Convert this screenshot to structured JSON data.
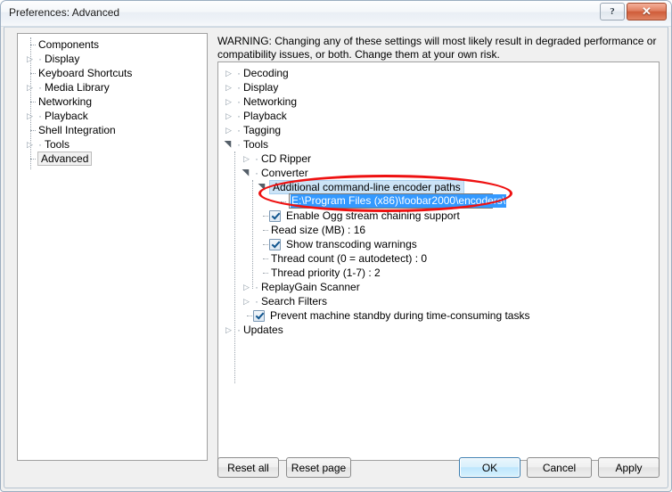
{
  "window": {
    "title": "Preferences: Advanced",
    "help_button": "?",
    "close_button": "✕"
  },
  "left_tree": {
    "items": [
      {
        "label": "Components",
        "expandable": false,
        "selected": false
      },
      {
        "label": "Display",
        "expandable": true,
        "selected": false
      },
      {
        "label": "Keyboard Shortcuts",
        "expandable": false,
        "selected": false
      },
      {
        "label": "Media Library",
        "expandable": true,
        "selected": false
      },
      {
        "label": "Networking",
        "expandable": false,
        "selected": false
      },
      {
        "label": "Playback",
        "expandable": true,
        "selected": false
      },
      {
        "label": "Shell Integration",
        "expandable": false,
        "selected": false
      },
      {
        "label": "Tools",
        "expandable": true,
        "selected": false
      },
      {
        "label": "Advanced",
        "expandable": false,
        "selected": true
      }
    ]
  },
  "warning": {
    "text": "WARNING: Changing any of these settings will most likely result in degraded performance or compatibility issues, or both. Change them at your own risk."
  },
  "right_tree": {
    "items": [
      {
        "label": "Decoding"
      },
      {
        "label": "Display"
      },
      {
        "label": "Networking"
      },
      {
        "label": "Playback"
      },
      {
        "label": "Tagging"
      },
      {
        "label": "Tools"
      },
      {
        "label": "CD Ripper"
      },
      {
        "label": "Converter"
      },
      {
        "label": "Additional command-line encoder paths"
      },
      {
        "label": "Enable Ogg stream chaining support"
      },
      {
        "label": "Read size (MB) : 16"
      },
      {
        "label": "Show transcoding warnings"
      },
      {
        "label": "Thread count (0 = autodetect) : 0"
      },
      {
        "label": "Thread priority (1-7) : 2"
      },
      {
        "label": "ReplayGain Scanner"
      },
      {
        "label": "Search Filters"
      },
      {
        "label": "Prevent machine standby during time-consuming tasks"
      },
      {
        "label": "Updates"
      }
    ]
  },
  "editor": {
    "value": "E:\\Program Files (x86)\\foobar2000\\encoders\\",
    "selected": true
  },
  "buttons": {
    "reset_all": "Reset all",
    "reset_page": "Reset page",
    "ok": "OK",
    "cancel": "Cancel",
    "apply": "Apply"
  },
  "annotation": {
    "shape": "ellipse",
    "color": "#ee1111"
  },
  "colors": {
    "selection_blue": "#3399ff",
    "tree_selection": "#cce4f7",
    "default_button_border": "#3c7fb1",
    "close_button": "#cf5c39"
  }
}
